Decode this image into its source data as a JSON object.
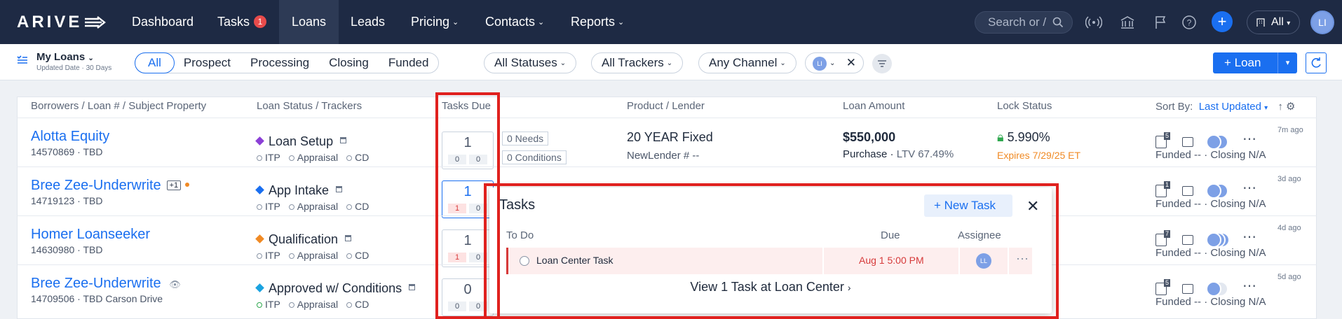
{
  "nav": {
    "logo": "ARIVE",
    "items": [
      {
        "label": "Dashboard"
      },
      {
        "label": "Tasks",
        "badge": "1"
      },
      {
        "label": "Loans"
      },
      {
        "label": "Leads"
      },
      {
        "label": "Pricing"
      },
      {
        "label": "Contacts"
      },
      {
        "label": "Reports"
      }
    ],
    "search_placeholder": "Search or /",
    "all_label": "All",
    "avatar": "LI"
  },
  "filters": {
    "view_title": "My Loans",
    "view_sub": "Updated Date · 30 Days",
    "segments": [
      "All",
      "Prospect",
      "Processing",
      "Closing",
      "Funded"
    ],
    "statuses": "All Statuses",
    "trackers": "All Trackers",
    "channel": "Any Channel",
    "user_chip": "LI",
    "loan_button": "+ Loan"
  },
  "table": {
    "headers": {
      "borrowers": "Borrowers / Loan # / Subject Property",
      "status": "Loan Status / Trackers",
      "tasks": "Tasks Due",
      "product": "Product / Lender",
      "amount": "Loan Amount",
      "lock": "Lock Status",
      "sort_label": "Sort By:",
      "sort_value": "Last Updated"
    },
    "trackers": [
      "ITP",
      "Appraisal",
      "CD"
    ],
    "rows": [
      {
        "name": "Alotta Equity",
        "sub": "14570869 · TBD",
        "status": "Loan Setup",
        "status_color": "#8b3fd6",
        "task_count": "1",
        "red": "0",
        "gray": "0",
        "needs": "0 Needs",
        "conditions": "0 Conditions",
        "product": "20 YEAR Fixed",
        "lender": "NewLender # --",
        "amount": "$550,000",
        "purpose": "Purchase",
        "ltv": "LTV 67.49%",
        "lock": "5.990%",
        "expires": "Expires 7/29/25 ET",
        "docs": "5",
        "funded": "Funded -- · Closing N/A",
        "ago": "7m ago"
      },
      {
        "name": "Bree Zee-Underwrite",
        "sub": "14719123 · TBD",
        "status": "App Intake",
        "status_color": "#1a6ff0",
        "task_count": "1",
        "red": "1",
        "gray": "0",
        "docs": "1",
        "funded": "Funded -- · Closing N/A",
        "ago": "3d ago",
        "extra": "+1"
      },
      {
        "name": "Homer Loanseeker",
        "sub": "14630980 · TBD",
        "status": "Qualification",
        "status_color": "#f08a24",
        "task_count": "1",
        "red": "1",
        "gray": "0",
        "docs": "7",
        "funded": "Funded -- · Closing N/A",
        "ago": "4d ago"
      },
      {
        "name": "Bree Zee-Underwrite",
        "sub": "14709506 · TBD Carson Drive",
        "status": "Approved w/ Conditions",
        "status_color": "#1aa3e0",
        "task_count": "0",
        "red": "0",
        "gray": "0",
        "docs": "5",
        "funded": "Funded -- · Closing N/A",
        "ago": "5d ago"
      }
    ]
  },
  "popup": {
    "title": "Tasks",
    "new_task": "+ New Task",
    "col_todo": "To Do",
    "col_due": "Due",
    "col_assignee": "Assignee",
    "task_name": "Loan Center Task",
    "task_due": "Aug 1 5:00 PM",
    "task_assignee": "LL",
    "view_link": "View 1 Task at Loan Center"
  },
  "colors": {
    "accent": "#1a6ff0",
    "nav_bg": "#1e2a44",
    "highlight": "#e0211e"
  }
}
